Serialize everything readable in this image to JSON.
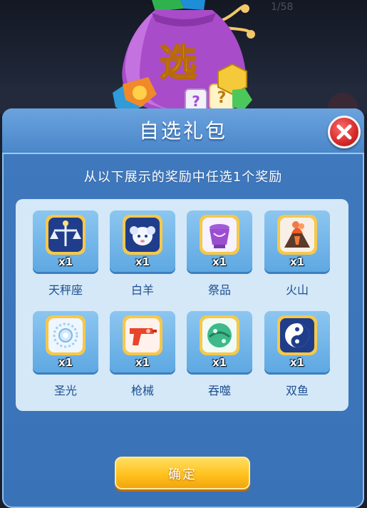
{
  "background": {
    "text": "1/58"
  },
  "bag": {
    "character": "选"
  },
  "dialog": {
    "title": "自选礼包",
    "subtitle": "从以下展示的奖励中任选1个奖励",
    "items": [
      {
        "name": "天秤座",
        "qty": "x1",
        "icon": "libra-icon"
      },
      {
        "name": "白羊",
        "qty": "x1",
        "icon": "aries-icon"
      },
      {
        "name": "祭品",
        "qty": "x1",
        "icon": "offering-icon"
      },
      {
        "name": "火山",
        "qty": "x1",
        "icon": "volcano-icon"
      },
      {
        "name": "圣光",
        "qty": "x1",
        "icon": "holy-light-icon"
      },
      {
        "name": "枪械",
        "qty": "x1",
        "icon": "gun-icon"
      },
      {
        "name": "吞噬",
        "qty": "x1",
        "icon": "devour-icon"
      },
      {
        "name": "双鱼",
        "qty": "x1",
        "icon": "pisces-icon"
      }
    ],
    "confirm_label": "确定"
  },
  "colors": {
    "dialog_blue": "#3f78bd",
    "panel_light": "#d4e8f8",
    "close_red": "#d42a2a",
    "confirm_gold": "#ffc21e",
    "item_name_blue": "#1d4f8f"
  }
}
